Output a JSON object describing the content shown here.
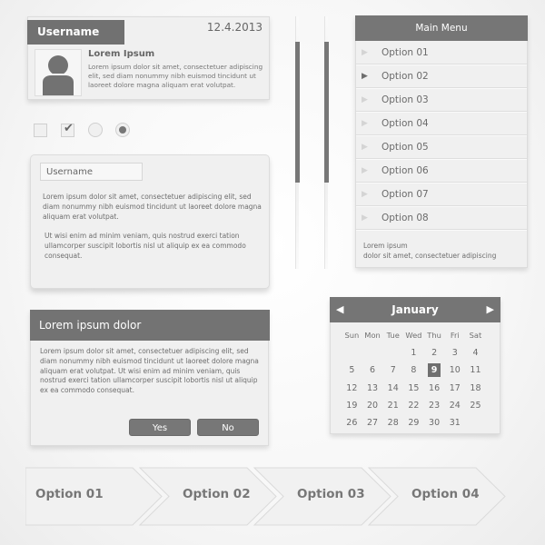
{
  "profile": {
    "username": "Username",
    "date": "12.4.2013",
    "name": "Lorem Ipsum",
    "description": "Lorem ipsum dolor sit amet, consectetuer adipiscing elit, sed diam nonummy nibh euismod tincidunt ut laoreet dolore magna aliquam erat volutpat."
  },
  "controls": {
    "checkbox_unchecked": false,
    "checkbox_checked": true,
    "radio_unselected": false,
    "radio_selected": true,
    "check_glyph": "✔"
  },
  "card": {
    "field_value": "Username",
    "paragraph1": "Lorem ipsum dolor sit amet, consectetuer adipiscing elit, sed diam nonummy nibh euismod tincidunt ut laoreet dolore magna aliquam erat volutpat.",
    "paragraph2": "Ut wisi enim ad minim veniam, quis nostrud exerci tation ullamcorper suscipit lobortis nisl ut aliquip ex ea commodo consequat."
  },
  "dialog": {
    "title": "Lorem ipsum dolor",
    "body": "Lorem ipsum dolor sit amet, consectetuer adipiscing elit, sed diam nonummy nibh euismod tincidunt ut laoreet dolore magna aliquam erat volutpat. Ut wisi enim ad minim veniam, quis nostrud exerci tation ullamcorper suscipit lobortis nisl ut aliquip ex ea commodo consequat.",
    "yes_label": "Yes",
    "no_label": "No"
  },
  "scrollbars": [
    {
      "thumb_start_fraction": 0.1,
      "thumb_size_fraction": 0.56
    },
    {
      "thumb_start_fraction": 0.1,
      "thumb_size_fraction": 0.56
    }
  ],
  "menu": {
    "title": "Main Menu",
    "arrow_glyph": "▶",
    "items": [
      {
        "label": "Option 01",
        "active": false
      },
      {
        "label": "Option 02",
        "active": true
      },
      {
        "label": "Option 03",
        "active": false
      },
      {
        "label": "Option 04",
        "active": false
      },
      {
        "label": "Option 05",
        "active": false
      },
      {
        "label": "Option 06",
        "active": false
      },
      {
        "label": "Option 07",
        "active": false
      },
      {
        "label": "Option 08",
        "active": false
      }
    ],
    "footer_line1": "Lorem ipsum",
    "footer_line2": "dolor sit amet, consectetuer adipiscing"
  },
  "calendar": {
    "month": "January",
    "prev_glyph": "◀",
    "next_glyph": "▶",
    "weekdays": [
      "Sun",
      "Mon",
      "Tue",
      "Wed",
      "Thu",
      "Fri",
      "Sat"
    ],
    "weeks": [
      [
        "",
        "",
        "",
        "1",
        "2",
        "3",
        "4"
      ],
      [
        "5",
        "6",
        "7",
        "8",
        "9",
        "10",
        "11"
      ],
      [
        "12",
        "13",
        "14",
        "15",
        "16",
        "17",
        "18"
      ],
      [
        "19",
        "20",
        "21",
        "22",
        "23",
        "24",
        "25"
      ],
      [
        "26",
        "27",
        "28",
        "29",
        "30",
        "31",
        ""
      ]
    ],
    "selected_day": "9"
  },
  "breadcrumb": {
    "items": [
      "Option 01",
      "Option 02",
      "Option 03",
      "Option 04"
    ]
  },
  "colors": {
    "header_gray": "#737373",
    "panel_bg": "#f0f0f0",
    "text_gray": "#6b6b6b"
  }
}
